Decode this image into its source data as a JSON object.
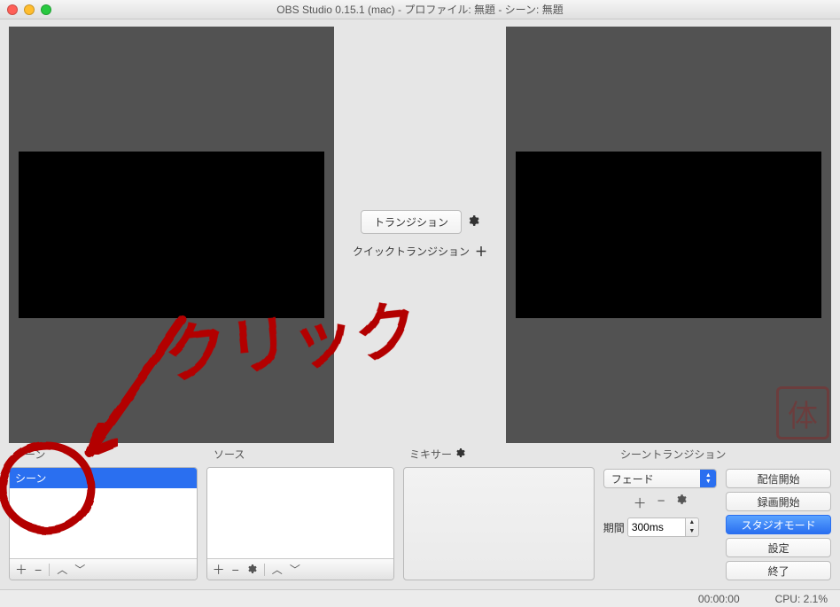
{
  "titlebar": {
    "title": "OBS Studio 0.15.1 (mac) - プロファイル: 無題 - シーン: 無題"
  },
  "center": {
    "transition_btn": "トランジション",
    "quick_transition_label": "クイックトランジション"
  },
  "panels": {
    "scenes_header": "シーン",
    "sources_header": "ソース",
    "mixer_header": "ミキサー",
    "scenetrans_header": "シーントランジション"
  },
  "scenes_list": {
    "items": [
      {
        "label": "シーン",
        "selected": true
      }
    ]
  },
  "scene_trans": {
    "fade_label": "フェード",
    "duration_label": "期間",
    "duration_value": "300ms"
  },
  "buttons": {
    "stream": "配信開始",
    "record": "録画開始",
    "studio": "スタジオモード",
    "settings": "設定",
    "exit": "終了"
  },
  "status": {
    "time": "00:00:00",
    "cpu": "CPU: 2.1%"
  },
  "annotation": {
    "text": "クリック"
  },
  "watermark": {
    "text": "体"
  }
}
